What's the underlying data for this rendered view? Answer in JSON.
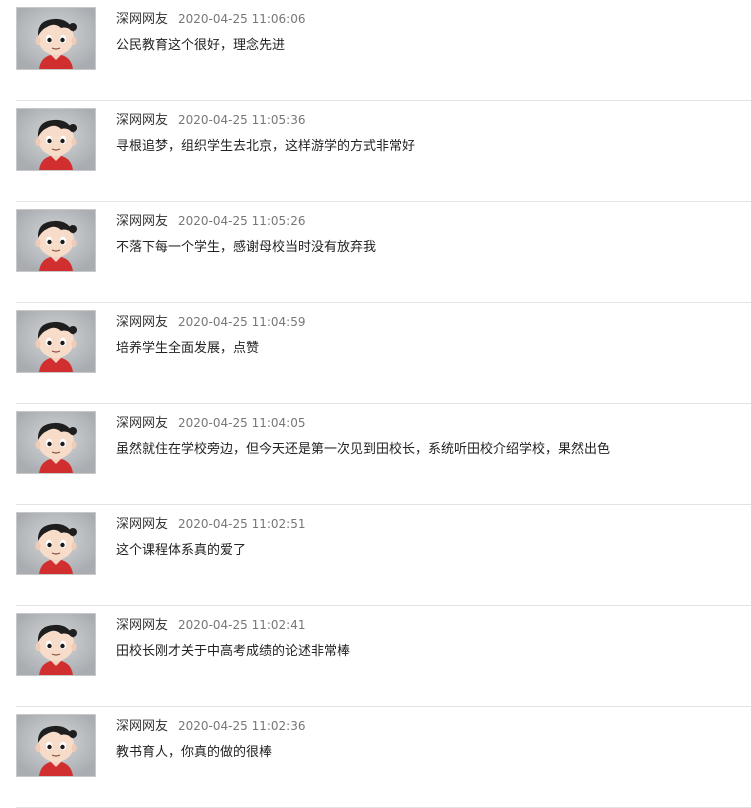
{
  "comments": [
    {
      "author": "深网网友",
      "time": "2020-04-25 11:06:06",
      "text": "公民教育这个很好，理念先进"
    },
    {
      "author": "深网网友",
      "time": "2020-04-25 11:05:36",
      "text": "寻根追梦，组织学生去北京，这样游学的方式非常好"
    },
    {
      "author": "深网网友",
      "time": "2020-04-25 11:05:26",
      "text": "不落下每一个学生，感谢母校当时没有放弃我"
    },
    {
      "author": "深网网友",
      "time": "2020-04-25 11:04:59",
      "text": "培养学生全面发展，点赞"
    },
    {
      "author": "深网网友",
      "time": "2020-04-25 11:04:05",
      "text": "虽然就住在学校旁边，但今天还是第一次见到田校长，系统听田校介绍学校，果然出色"
    },
    {
      "author": "深网网友",
      "time": "2020-04-25 11:02:51",
      "text": "这个课程体系真的爱了"
    },
    {
      "author": "深网网友",
      "time": "2020-04-25 11:02:41",
      "text": "田校长刚才关于中高考成绩的论述非常棒"
    },
    {
      "author": "深网网友",
      "time": "2020-04-25 11:02:36",
      "text": "教书育人，你真的做的很棒"
    }
  ],
  "avatar_icon": "default-user-avatar-icon"
}
